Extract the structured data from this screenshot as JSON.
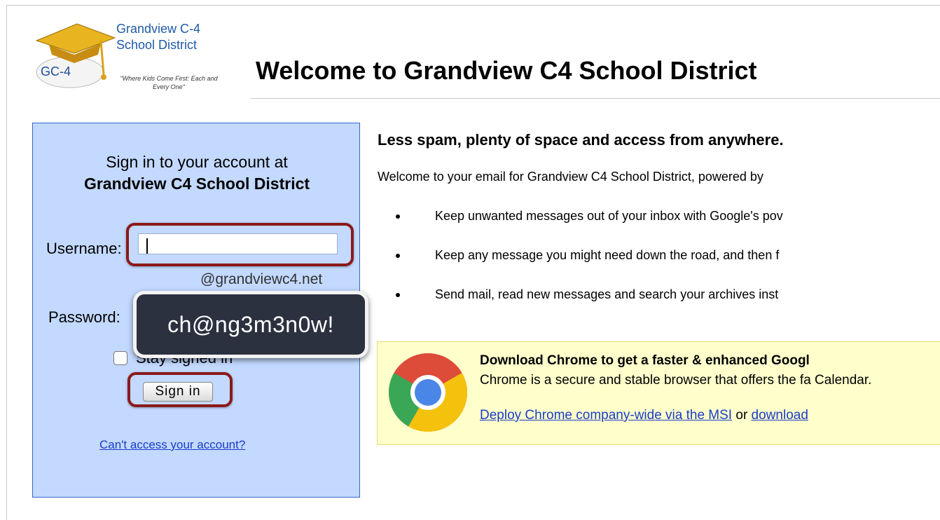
{
  "logo": {
    "badge": "GC-4",
    "name": "Grandview C-4 School District",
    "tagline": "\"Where Kids Come First: Each and Every One\""
  },
  "header": {
    "title": "Welcome to Grandview C4 School District"
  },
  "signin": {
    "heading": "Sign in to your account at",
    "org": "Grandview C4 School District",
    "username_label": "Username:",
    "username_value": "",
    "domain_hint": "@grandviewc4.net",
    "password_label": "Password:",
    "stay_signed_in_label": "Stay signed in",
    "stay_signed_in_checked": false,
    "signin_button": "Sign in",
    "cant_access_link": "Can't access your account?"
  },
  "callout": {
    "password_example": "ch@ng3m3n0w!"
  },
  "main": {
    "subheading": "Less spam, plenty of space and access from anywhere.",
    "intro": "Welcome to your email for Grandview C4 School District, powered by",
    "bullets": [
      "Keep unwanted messages out of your inbox with Google's pov",
      "Keep any message you might need down the road, and then f",
      "Send mail, read new messages and search your archives inst"
    ]
  },
  "chrome_promo": {
    "title": "Download Chrome to get a faster & enhanced Googl",
    "description": "Chrome is a secure and stable browser that offers the fa Calendar.",
    "deploy_link": "Deploy Chrome company-wide via the MSI",
    "or_text": " or ",
    "download_link": "download"
  },
  "colors": {
    "signin_bg": "#c3d9ff",
    "highlight": "#8b1a1a",
    "link": "#1a3cc6",
    "promo_bg": "#ffffcc"
  }
}
